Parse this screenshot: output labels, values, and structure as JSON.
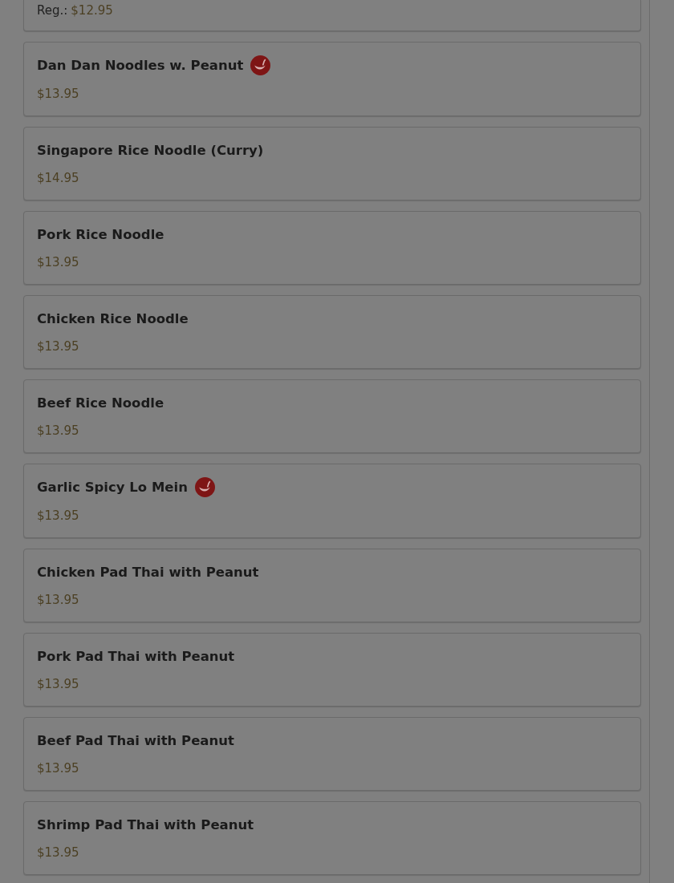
{
  "menu_items": [
    {
      "kind": "partial",
      "price_label": "Reg.:",
      "price": "$12.95"
    },
    {
      "kind": "item",
      "name": "Dan Dan Noodles w. Peanut",
      "spicy": true,
      "price": "$13.95"
    },
    {
      "kind": "item",
      "name": "Singapore Rice Noodle (Curry)",
      "spicy": false,
      "price": "$14.95"
    },
    {
      "kind": "item",
      "name": "Pork Rice Noodle",
      "spicy": false,
      "price": "$13.95"
    },
    {
      "kind": "item",
      "name": "Chicken Rice Noodle",
      "spicy": false,
      "price": "$13.95"
    },
    {
      "kind": "item",
      "name": "Beef Rice Noodle",
      "spicy": false,
      "price": "$13.95"
    },
    {
      "kind": "item",
      "name": "Garlic Spicy Lo Mein",
      "spicy": true,
      "price": "$13.95"
    },
    {
      "kind": "item",
      "name": "Chicken Pad Thai with Peanut",
      "spicy": false,
      "price": "$13.95"
    },
    {
      "kind": "item",
      "name": "Pork Pad Thai with Peanut",
      "spicy": false,
      "price": "$13.95"
    },
    {
      "kind": "item",
      "name": "Beef Pad Thai with Peanut",
      "spicy": false,
      "price": "$13.95"
    },
    {
      "kind": "item",
      "name": "Shrimp Pad Thai with Peanut",
      "spicy": false,
      "price": "$13.95"
    }
  ]
}
